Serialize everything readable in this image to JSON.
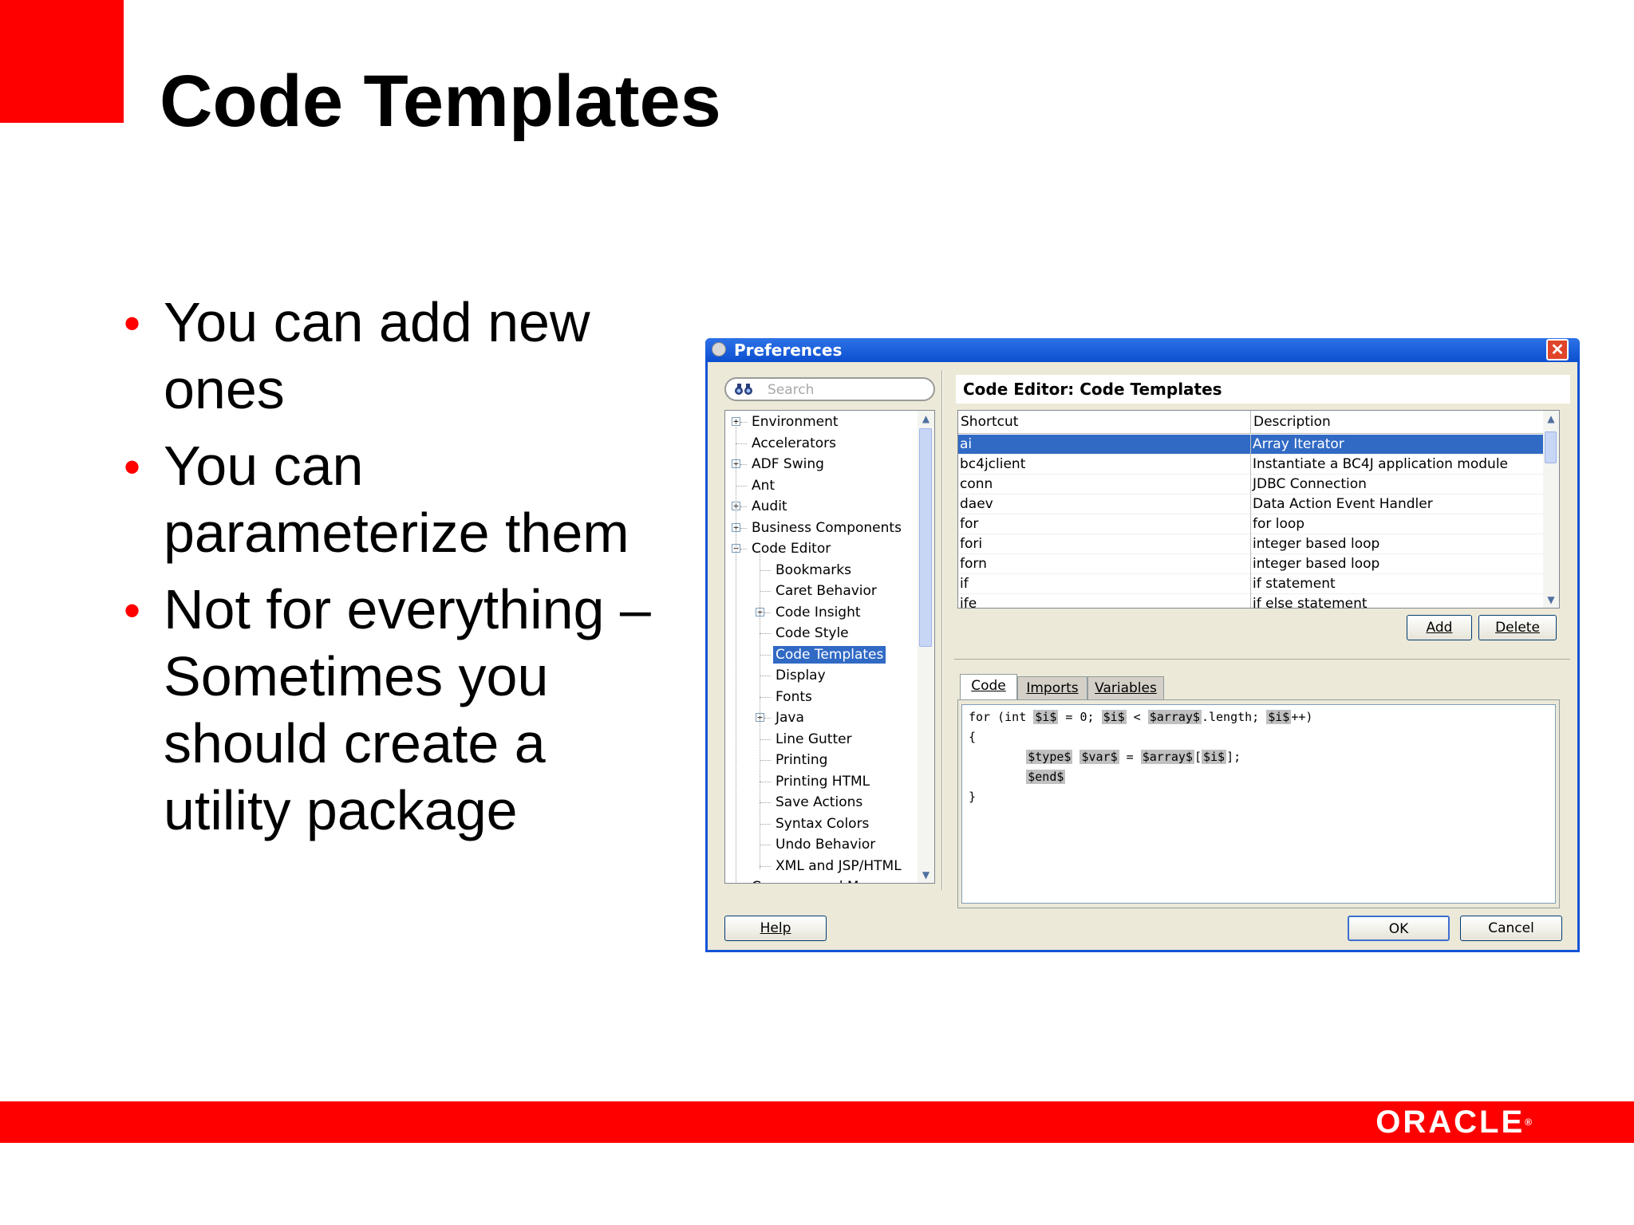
{
  "slide": {
    "title": "Code Templates",
    "bullets": [
      "You can add new ones",
      "You can parameterize them",
      "Not for everything – Sometimes you should create a utility package"
    ],
    "footer_logo": "ORACLE",
    "colors": {
      "accent": "#ff0000",
      "window_blue": "#1454d6",
      "selection": "#316ac5"
    }
  },
  "window": {
    "title": "Preferences",
    "search_placeholder": "Search",
    "tree": [
      {
        "label": "Environment",
        "level": 0,
        "expander": "+"
      },
      {
        "label": "Accelerators",
        "level": 0,
        "expander": ""
      },
      {
        "label": "ADF Swing",
        "level": 0,
        "expander": "+"
      },
      {
        "label": "Ant",
        "level": 0,
        "expander": ""
      },
      {
        "label": "Audit",
        "level": 0,
        "expander": "+"
      },
      {
        "label": "Business Components",
        "level": 0,
        "expander": "+"
      },
      {
        "label": "Code Editor",
        "level": 0,
        "expander": "−"
      },
      {
        "label": "Bookmarks",
        "level": 1,
        "expander": ""
      },
      {
        "label": "Caret Behavior",
        "level": 1,
        "expander": ""
      },
      {
        "label": "Code Insight",
        "level": 1,
        "expander": "+"
      },
      {
        "label": "Code Style",
        "level": 1,
        "expander": ""
      },
      {
        "label": "Code Templates",
        "level": 1,
        "expander": "",
        "selected": true
      },
      {
        "label": "Display",
        "level": 1,
        "expander": ""
      },
      {
        "label": "Fonts",
        "level": 1,
        "expander": ""
      },
      {
        "label": "Java",
        "level": 1,
        "expander": "+"
      },
      {
        "label": "Line Gutter",
        "level": 1,
        "expander": ""
      },
      {
        "label": "Printing",
        "level": 1,
        "expander": ""
      },
      {
        "label": "Printing HTML",
        "level": 1,
        "expander": ""
      },
      {
        "label": "Save Actions",
        "level": 1,
        "expander": ""
      },
      {
        "label": "Syntax Colors",
        "level": 1,
        "expander": ""
      },
      {
        "label": "Undo Behavior",
        "level": 1,
        "expander": ""
      },
      {
        "label": "XML and JSP/HTML",
        "level": 1,
        "expander": ""
      },
      {
        "label": "Compare and Merge",
        "level": 0,
        "expander": ""
      }
    ],
    "panel_heading": "Code Editor: Code Templates",
    "table": {
      "columns": [
        "Shortcut",
        "Description"
      ],
      "rows": [
        {
          "shortcut": "ai",
          "description": "Array Iterator",
          "selected": true
        },
        {
          "shortcut": "bc4jclient",
          "description": "Instantiate a BC4J application module"
        },
        {
          "shortcut": "conn",
          "description": "JDBC Connection"
        },
        {
          "shortcut": "daev",
          "description": "Data Action Event Handler"
        },
        {
          "shortcut": "for",
          "description": "for loop"
        },
        {
          "shortcut": "fori",
          "description": "integer based loop"
        },
        {
          "shortcut": "forn",
          "description": "integer based loop"
        },
        {
          "shortcut": "if",
          "description": "if statement"
        },
        {
          "shortcut": "ife",
          "description": "if else statement"
        }
      ]
    },
    "buttons": {
      "add": "Add",
      "delete": "Delete",
      "help": "Help",
      "ok": "OK",
      "cancel": "Cancel"
    },
    "tabs": [
      "Code",
      "Imports",
      "Variables"
    ],
    "code": {
      "line1": [
        {
          "t": "for (int ",
          "v": false
        },
        {
          "t": "$i$",
          "v": true
        },
        {
          "t": " = 0; ",
          "v": false
        },
        {
          "t": "$i$",
          "v": true
        },
        {
          "t": " < ",
          "v": false
        },
        {
          "t": "$array$",
          "v": true
        },
        {
          "t": ".length; ",
          "v": false
        },
        {
          "t": "$i$",
          "v": true
        },
        {
          "t": "++)",
          "v": false
        }
      ],
      "line2": [
        {
          "t": "{",
          "v": false
        }
      ],
      "line3": [
        {
          "t": "        ",
          "v": false
        },
        {
          "t": "$type$",
          "v": true
        },
        {
          "t": " ",
          "v": false
        },
        {
          "t": "$var$",
          "v": true
        },
        {
          "t": " = ",
          "v": false
        },
        {
          "t": "$array$",
          "v": true
        },
        {
          "t": "[",
          "v": false
        },
        {
          "t": "$i$",
          "v": true
        },
        {
          "t": "];",
          "v": false
        }
      ],
      "line4": [
        {
          "t": "        ",
          "v": false
        },
        {
          "t": "$end$",
          "v": true
        }
      ],
      "line5": [
        {
          "t": "}",
          "v": false
        }
      ]
    }
  }
}
